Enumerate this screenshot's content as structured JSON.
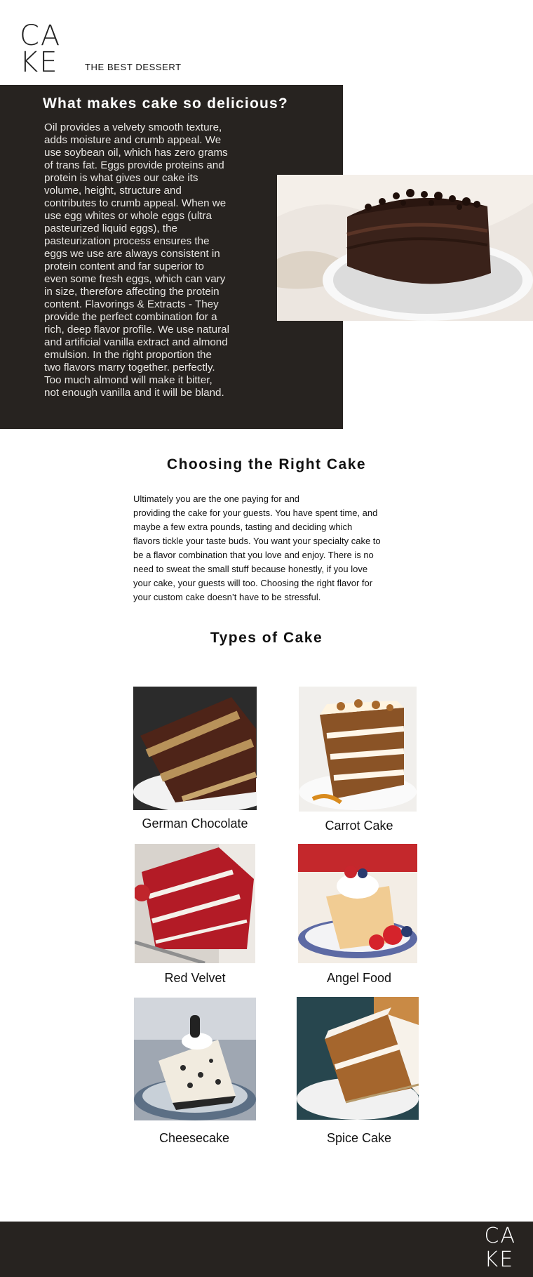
{
  "header": {
    "logo_top": "CA",
    "logo_bottom": "KE",
    "tagline": "THE BEST DESSERT"
  },
  "hero": {
    "title": "What makes cake so delicious?",
    "text": "Oil  provides a velvety smooth texture,\nadds moisture and crumb appeal. We\nuse soybean oil, which has zero grams\nof trans fat.  Eggs provide proteins and\nprotein is what gives our cake its\nvolume, height, structure and\ncontributes to crumb appeal. When we\nuse egg whites or whole eggs (ultra\npasteurized liquid eggs), the\n pasteurization process ensures the\neggs we use are always consistent in\nprotein content and far superior to\neven some fresh eggs, which can vary\nin size, therefore affecting the protein\ncontent. Flavorings & Extracts - They\nprovide the perfect combination for a\nrich, deep flavor profile. We use natural\nand artificial vanilla extract and almond\nemulsion. In the right proportion the\ntwo flavors marry together. perfectly.\nToo much almond will make it bitter,\nnot enough vanilla and it will be bland."
  },
  "choosing": {
    "title": "Choosing the Right Cake",
    "text": "Ultimately you are the one paying for and\nproviding the cake for your guests. You have spent time, and\nmaybe a few extra pounds, tasting and deciding which\nflavors tickle your taste buds. You want your specialty cake to\nbe a flavor combination that you love and enjoy. There is no\nneed to sweat the small stuff because honestly, if you love\nyour cake, your guests will too. Choosing the right flavor for\nyour custom cake doesn’t have to be stressful."
  },
  "types": {
    "title": "Types of Cake",
    "cakes": [
      {
        "label": "German Chocolate"
      },
      {
        "label": "Carrot Cake"
      },
      {
        "label": "Red Velvet"
      },
      {
        "label": "Angel Food"
      },
      {
        "label": "Cheesecake"
      },
      {
        "label": "Spice Cake"
      }
    ]
  },
  "footer": {
    "logo_top": "CA",
    "logo_bottom": "KE"
  },
  "colors": {
    "dark_panel": "#272320",
    "hero_title": "#ffffff",
    "body_text": "#111111"
  }
}
